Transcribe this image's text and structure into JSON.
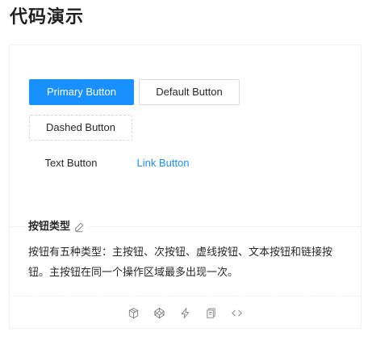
{
  "page": {
    "title": "代码演示"
  },
  "demo": {
    "primary_label": "Primary Button",
    "default_label": "Default Button",
    "dashed_label": "Dashed Button",
    "text_label": "Text Button",
    "link_label": "Link Button"
  },
  "meta": {
    "title": "按钮类型",
    "description": "按钮有五种类型：主按钮、次按钮、虚线按钮、文本按钮和链接按钮。主按钮在同一个操作区域最多出现一次。"
  },
  "actions": {
    "icons": [
      "codesandbox-icon",
      "codepen-icon",
      "stackblitz-icon",
      "copy-icon",
      "expand-code-icon"
    ]
  },
  "colors": {
    "primary": "#1890ff",
    "border": "#d9d9d9",
    "divider": "#f0f0f0",
    "icon": "rgba(0,0,0,.45)"
  }
}
